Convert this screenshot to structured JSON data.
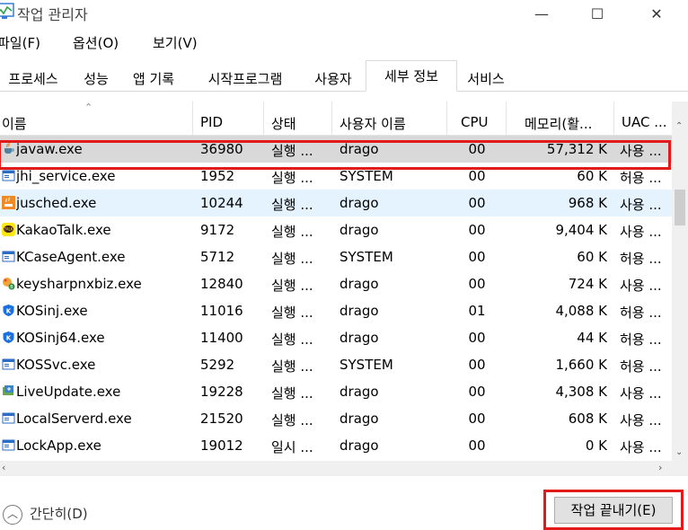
{
  "window": {
    "title": "작업 관리자",
    "minimize": "—",
    "maximize": "☐",
    "close": "✕"
  },
  "menu": [
    "파일(F)",
    "옵션(O)",
    "보기(V)"
  ],
  "tabs": [
    "프로세스",
    "성능",
    "앱 기록",
    "시작프로그램",
    "사용자",
    "세부 정보",
    "서비스"
  ],
  "active_tab": "세부 정보",
  "columns": {
    "name": "이름",
    "pid": "PID",
    "status": "상태",
    "user": "사용자 이름",
    "cpu": "CPU",
    "memory": "메모리(활...",
    "uac": "UAC ..."
  },
  "rows": [
    {
      "name": "javaw.exe",
      "pid": "36980",
      "status": "실행 ...",
      "user": "drago",
      "cpu": "00",
      "memory": "57,312 K",
      "uac": "사용 ...",
      "icon": "java-cup-icon"
    },
    {
      "name": "jhi_service.exe",
      "pid": "1952",
      "status": "실행 ...",
      "user": "SYSTEM",
      "cpu": "00",
      "memory": "60 K",
      "uac": "허용 ...",
      "icon": "window-app-icon"
    },
    {
      "name": "jusched.exe",
      "pid": "10244",
      "status": "실행 ...",
      "user": "drago",
      "cpu": "00",
      "memory": "968 K",
      "uac": "사용 ...",
      "icon": "java-update-icon"
    },
    {
      "name": "KakaoTalk.exe",
      "pid": "9172",
      "status": "실행 ...",
      "user": "drago",
      "cpu": "00",
      "memory": "9,404 K",
      "uac": "사용 ...",
      "icon": "kakaotalk-icon"
    },
    {
      "name": "KCaseAgent.exe",
      "pid": "5712",
      "status": "실행 ...",
      "user": "SYSTEM",
      "cpu": "00",
      "memory": "60 K",
      "uac": "허용 ...",
      "icon": "window-app-icon"
    },
    {
      "name": "keysharpnxbiz.exe",
      "pid": "12840",
      "status": "실행 ...",
      "user": "drago",
      "cpu": "00",
      "memory": "724 K",
      "uac": "사용 ...",
      "icon": "keysharp-icon"
    },
    {
      "name": "KOSinj.exe",
      "pid": "11016",
      "status": "실행 ...",
      "user": "drago",
      "cpu": "01",
      "memory": "4,088 K",
      "uac": "허용 ...",
      "icon": "kos-shield-icon"
    },
    {
      "name": "KOSinj64.exe",
      "pid": "11400",
      "status": "실행 ...",
      "user": "drago",
      "cpu": "00",
      "memory": "44 K",
      "uac": "허용 ...",
      "icon": "kos-shield-icon"
    },
    {
      "name": "KOSSvc.exe",
      "pid": "5292",
      "status": "실행 ...",
      "user": "SYSTEM",
      "cpu": "00",
      "memory": "1,660 K",
      "uac": "허용 ...",
      "icon": "window-app-icon"
    },
    {
      "name": "LiveUpdate.exe",
      "pid": "19228",
      "status": "실행 ...",
      "user": "drago",
      "cpu": "00",
      "memory": "4,308 K",
      "uac": "사용 ...",
      "icon": "liveupdate-icon"
    },
    {
      "name": "LocalServerd.exe",
      "pid": "21520",
      "status": "실행 ...",
      "user": "drago",
      "cpu": "00",
      "memory": "608 K",
      "uac": "사용 ...",
      "icon": "window-app-icon"
    },
    {
      "name": "LockApp.exe",
      "pid": "19012",
      "status": "일시 ...",
      "user": "drago",
      "cpu": "00",
      "memory": "0 K",
      "uac": "사용 ...",
      "icon": "window-app-icon"
    }
  ],
  "footer": {
    "fewer_details": "간단히(D)",
    "end_task": "작업 끝내기(E)"
  },
  "colors": {
    "highlight": "#e21a1a",
    "selected_row": "#d9d9d9",
    "hover_row": "#e5f3ff"
  }
}
